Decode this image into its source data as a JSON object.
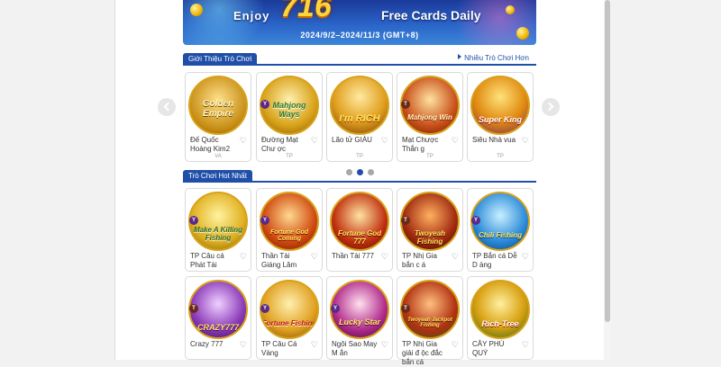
{
  "banner": {
    "enjoy": "Enjoy",
    "amount": "716",
    "free_text": "Free Cards Daily",
    "dates": "2024/9/2–2024/11/3 (GMT+8)"
  },
  "section_intro": {
    "title": "Giới Thiệu Trò Chơi",
    "more_link": "Nhiều Trò Chơi Hơn",
    "cards": [
      {
        "art_text": "Golden Empire",
        "title": "Đế Quốc Hoàng Kim2",
        "tag": "VA"
      },
      {
        "art_text": "Mahjong Ways",
        "title": "Đường Mạt Chư ợc",
        "tag": "TP"
      },
      {
        "art_text": "I'm RICH",
        "title": "Lão tử GIÀU",
        "tag": "TP"
      },
      {
        "art_text": "Mahjong Win",
        "title": "Mạt Chược Thắn g",
        "tag": "TP"
      },
      {
        "art_text": "Super King",
        "title": "Siêu Nhà vua",
        "tag": "TP"
      }
    ]
  },
  "section_hot": {
    "title": "Trò Chơi Hot Nhất",
    "cards": [
      {
        "art_text": "Make A Killing Fishing",
        "title": "TP Câu cá Phát Tài"
      },
      {
        "art_text": "Fortune God Coming",
        "title": "Thần Tài Giáng Lâm"
      },
      {
        "art_text": "Fortune God 777",
        "title": "Thần Tài 777"
      },
      {
        "art_text": "Twoyeah Fishing",
        "title": "TP Nhị Gia bắn c á"
      },
      {
        "art_text": "Chili Fishing",
        "title": "TP Bắn cá Dễ D àng"
      },
      {
        "art_text": "CRAZY777",
        "title": "Crazy 777"
      },
      {
        "art_text": "Fortune Fishing",
        "title": "TP Câu Cá Vàng"
      },
      {
        "art_text": "Lucky Star",
        "title": "Ngôi Sao May M ắn"
      },
      {
        "art_text": "Twoyeah Jackpot Fishing",
        "title": "TP Nhị Gia giải đ ộc đắc bắn cá"
      },
      {
        "art_text": "Rich-Tree",
        "title": "CÂY PHÚ QUÝ"
      }
    ]
  },
  "carousel": {
    "active_index": 1
  },
  "colors": {
    "accent": "#1f4fa8",
    "gold": "#d8a21a"
  }
}
